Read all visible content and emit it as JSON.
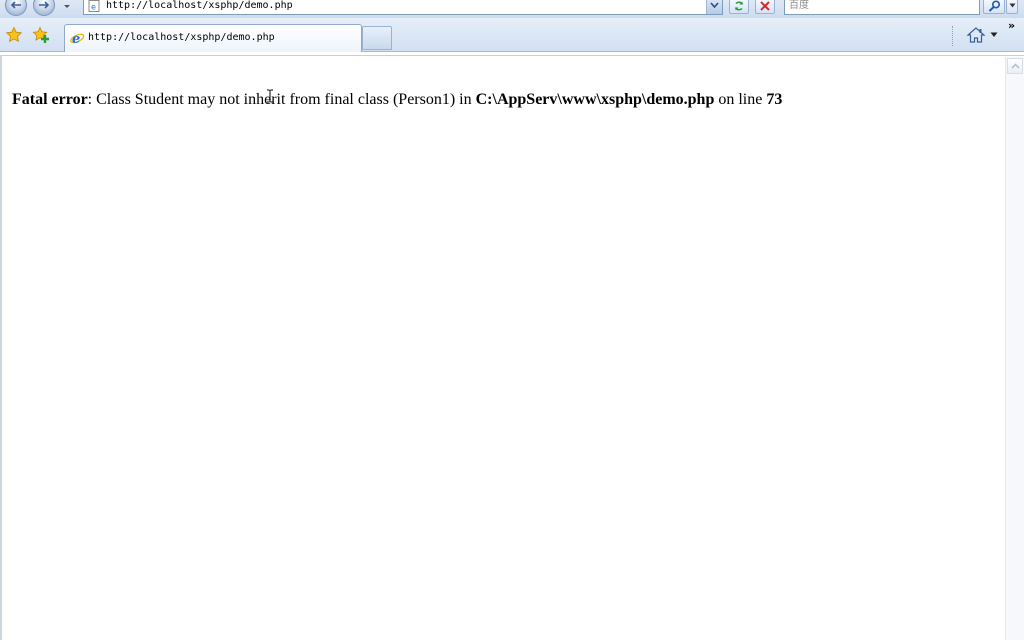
{
  "address_bar": {
    "url": "http://localhost/xsphp/demo.php"
  },
  "search": {
    "placeholder": "百度"
  },
  "tab": {
    "label": "http://localhost/xsphp/demo.php"
  },
  "toolbar": {
    "chevrons": "»"
  },
  "error": {
    "label": "Fatal error",
    "message_prefix": ": Class Student may not inherit from final class (Person1) in ",
    "file_path": "C:\\AppServ\\www\\xsphp\\demo.php",
    "line_text": " on line ",
    "line_number": "73"
  },
  "colors": {
    "chrome_blue": "#d2e0f2",
    "error_text": "#000000",
    "page_background": "#ffffff"
  }
}
